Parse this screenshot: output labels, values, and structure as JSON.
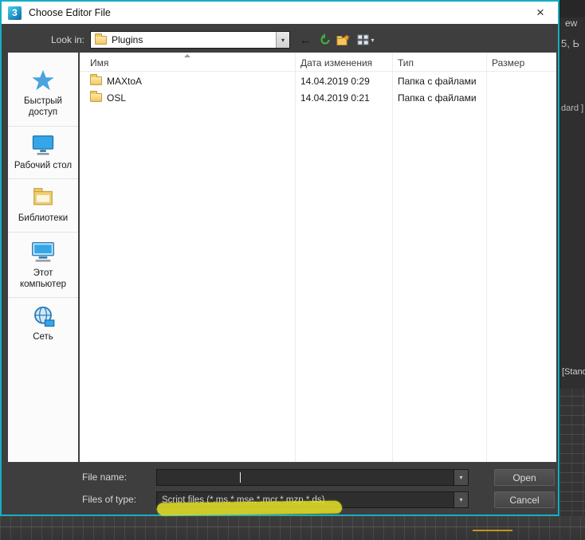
{
  "window": {
    "title": "Choose Editor File"
  },
  "glyphs": {
    "logo": "3",
    "close": "×",
    "dropdown": "▾",
    "back": "←"
  },
  "toolbar": {
    "look_in_label": "Look in:",
    "look_in_value": "Plugins"
  },
  "places": {
    "items": [
      {
        "label": "Быстрый доступ",
        "icon": "quick-access-icon"
      },
      {
        "label": "Рабочий стол",
        "icon": "desktop-icon"
      },
      {
        "label": "Библиотеки",
        "icon": "libraries-icon"
      },
      {
        "label": "Этот компьютер",
        "icon": "this-pc-icon"
      },
      {
        "label": "Сеть",
        "icon": "network-icon"
      }
    ]
  },
  "file_list": {
    "columns": [
      "Имя",
      "Дата изменения",
      "Тип",
      "Размер"
    ],
    "rows": [
      {
        "name": "MAXtoA",
        "date": "14.04.2019 0:29",
        "type": "Папка с файлами",
        "size": ""
      },
      {
        "name": "OSL",
        "date": "14.04.2019 0:21",
        "type": "Папка с файлами",
        "size": ""
      }
    ]
  },
  "footer": {
    "file_name_label": "File name:",
    "file_name_value": "",
    "files_of_type_label": "Files of type:",
    "files_of_type_value": "Script files (*.ms,*.mse,*.mcr,*.mzp,*.ds)",
    "open_label": "Open",
    "cancel_label": "Cancel"
  },
  "background": {
    "partial_texts": [
      "ew",
      "5, Ь",
      "dard ]",
      "[Stand"
    ]
  },
  "colors": {
    "accent_border": "#16aec2",
    "marker": "#e6e326",
    "dialog_chrome": "#3e3e3e"
  }
}
